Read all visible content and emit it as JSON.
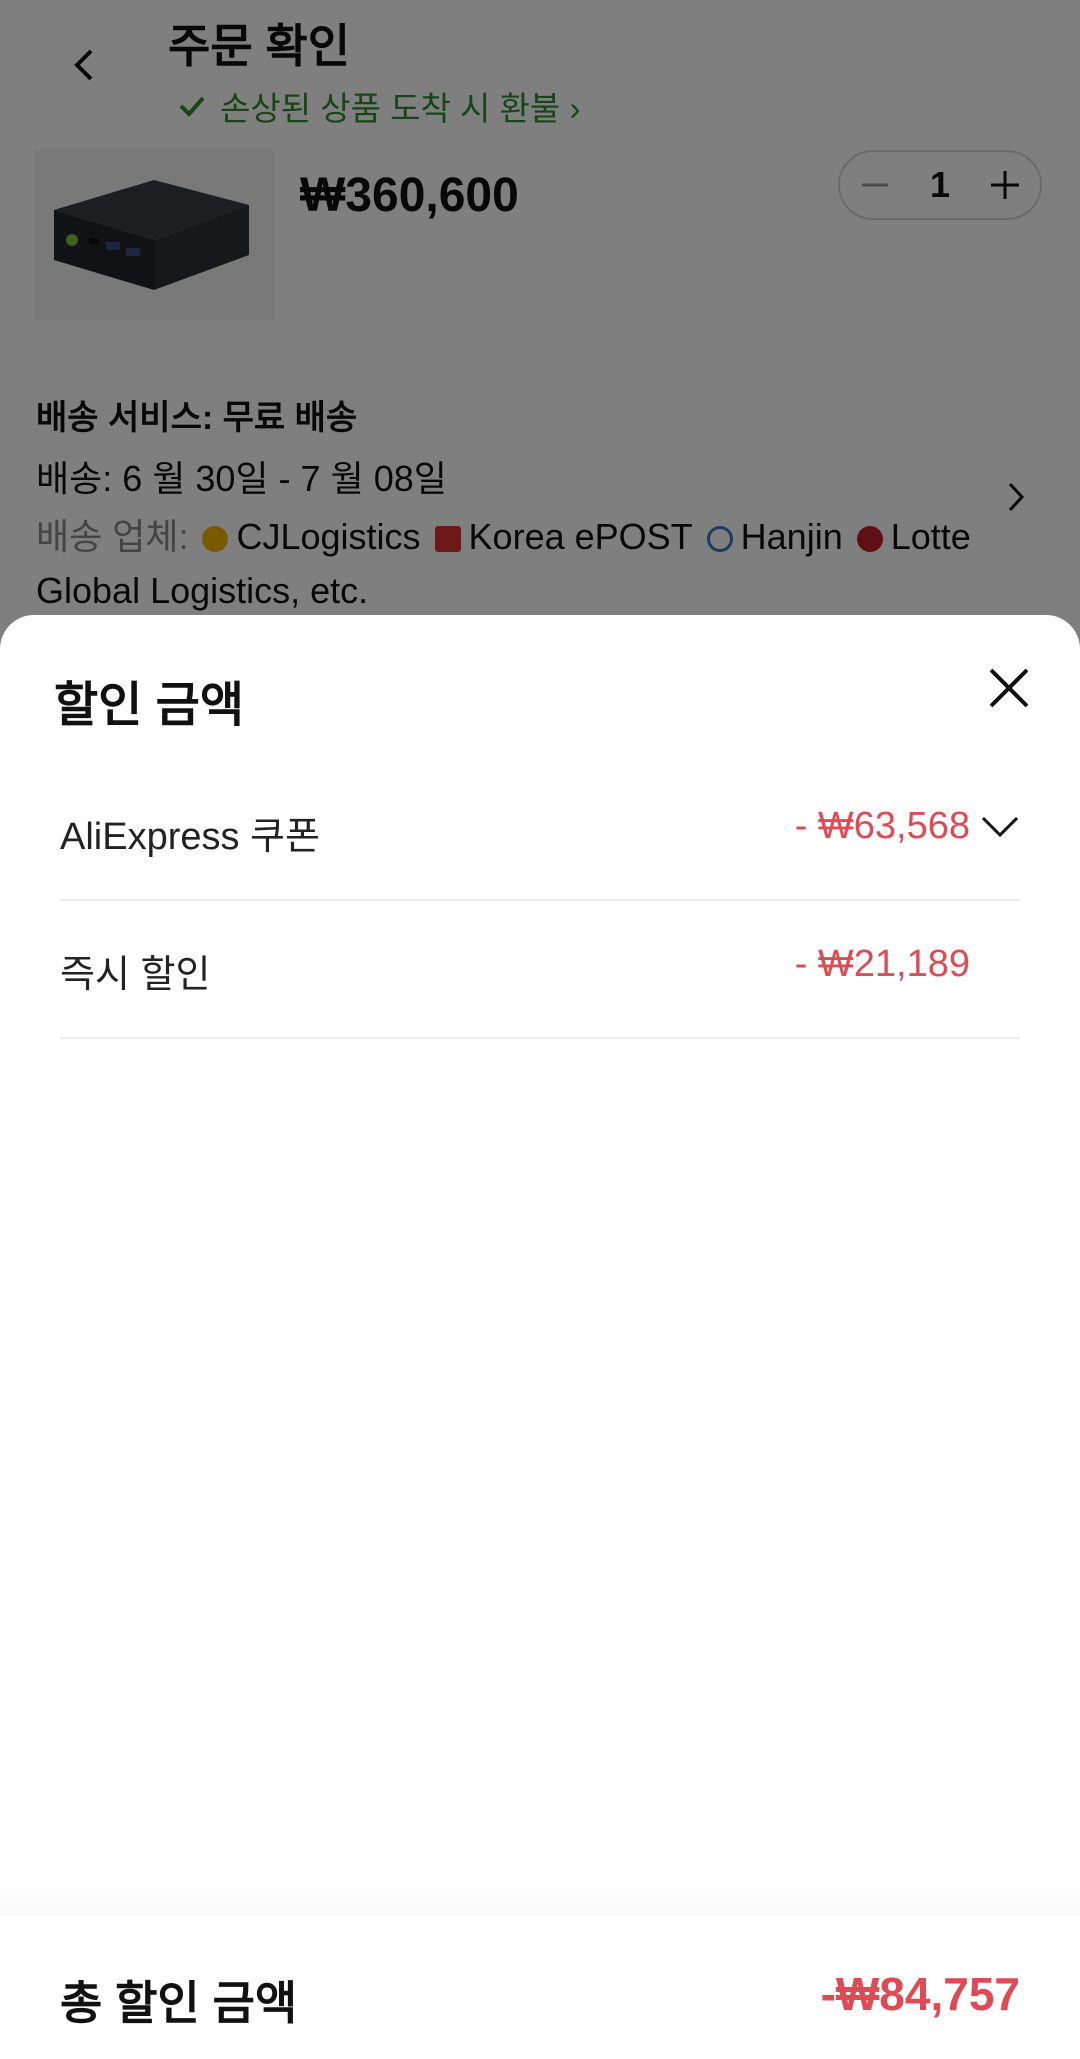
{
  "header": {
    "title": "주문 확인",
    "refund_text": "손상된 상품 도착 시 환불 ›"
  },
  "product": {
    "price": "₩360,600",
    "quantity": "1"
  },
  "shipping": {
    "service": "배송 서비스:  무료 배송",
    "date": "배송: 6 월 30일 - 7 월 08일",
    "carriers_label": "배송 업체:",
    "carriers": [
      "CJLogistics",
      "Korea ePOST",
      "Hanjin",
      "Lotte Global Logistics, etc."
    ]
  },
  "sheet": {
    "title": "할인 금액",
    "rows": [
      {
        "label": "AliExpress 쿠폰",
        "value": "- ₩63,568"
      },
      {
        "label": "즉시 할인",
        "value": "- ₩21,189"
      }
    ],
    "total_label": "총 할인 금액",
    "total_value": "-₩84,757"
  },
  "colors": {
    "accent_red": "#e04a55",
    "refund_green": "#2f8a2f"
  },
  "icons": [
    "back-arrow-icon",
    "checkmark-icon",
    "minus-icon",
    "plus-icon",
    "chevron-right-icon",
    "close-icon",
    "chevron-down-icon"
  ]
}
